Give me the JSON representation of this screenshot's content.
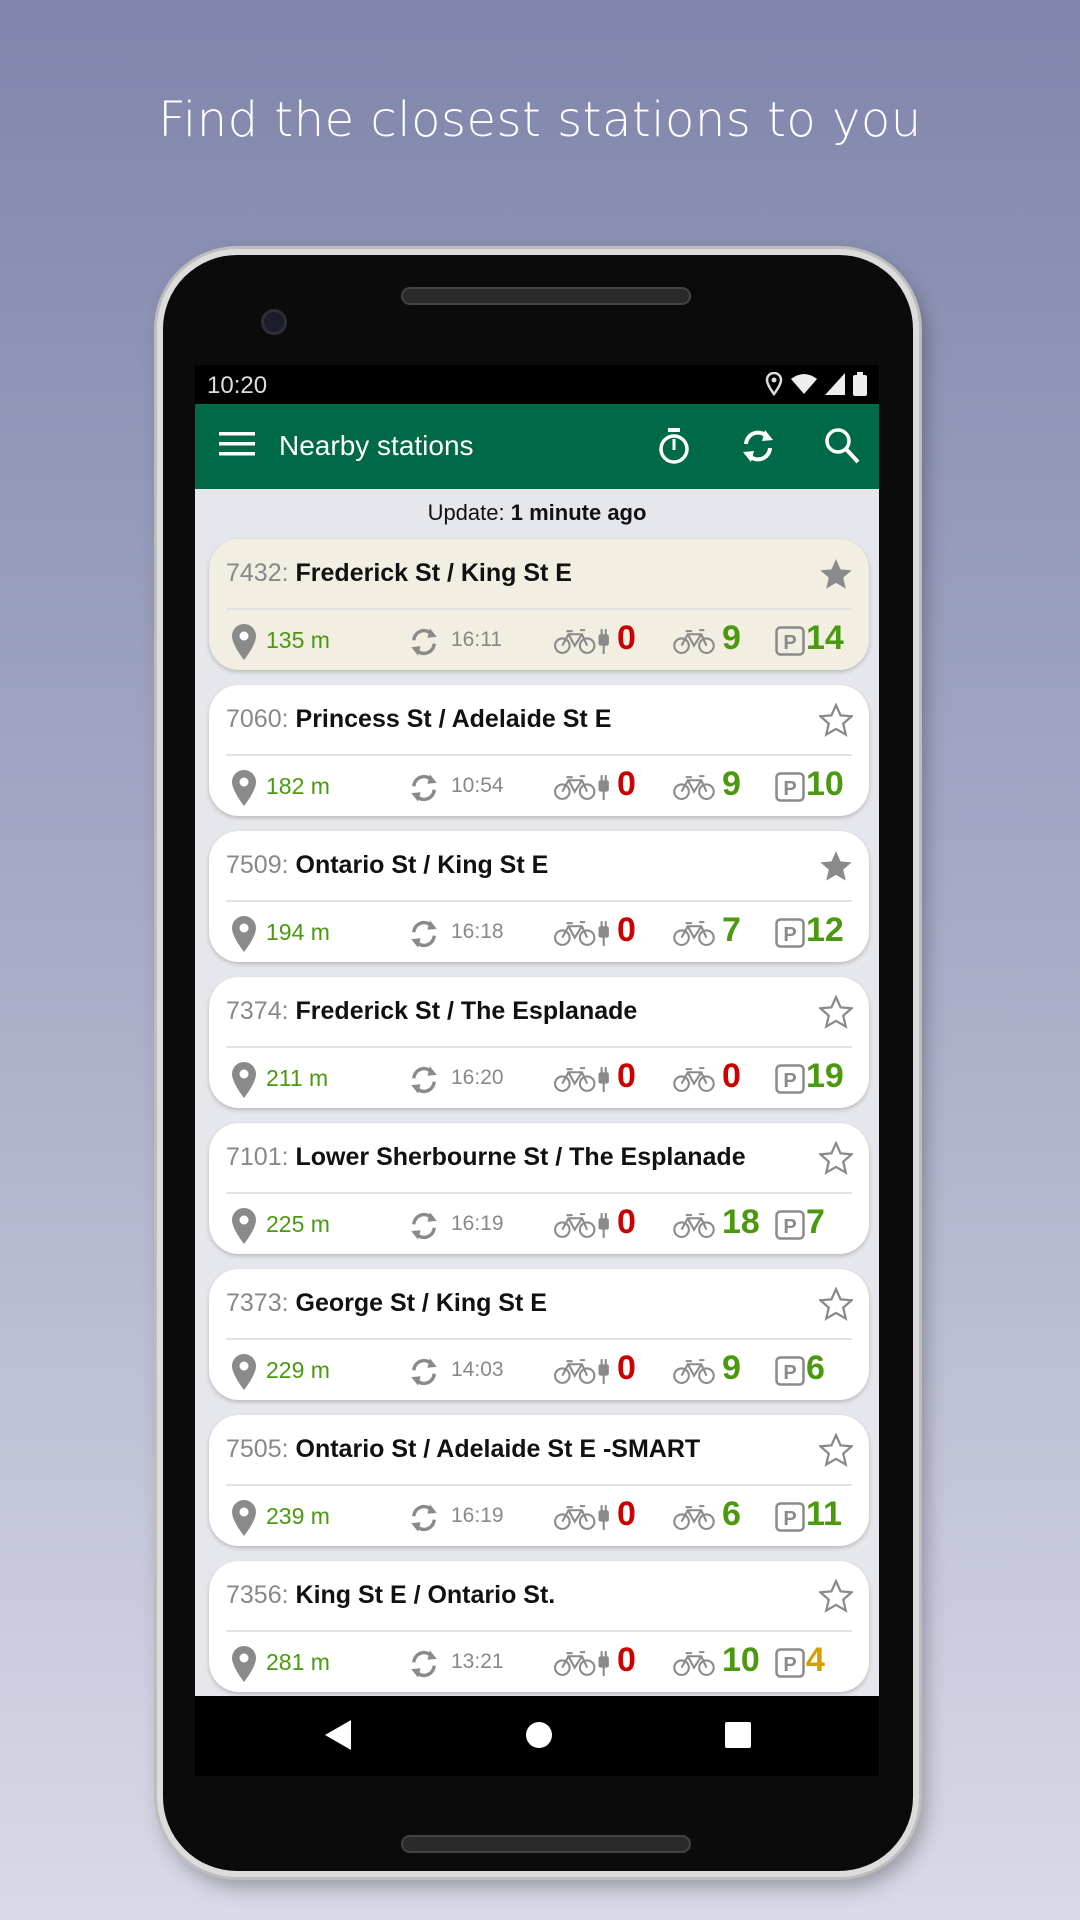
{
  "headline": "Find the closest stations to you",
  "status_bar": {
    "time": "10:20"
  },
  "app_bar": {
    "title": "Nearby stations",
    "icons": [
      "menu-icon",
      "timer-icon",
      "refresh-icon",
      "search-icon"
    ]
  },
  "update": {
    "label": "Update:",
    "value": "1 minute ago"
  },
  "colors": {
    "app_bar": "#006947",
    "distance": "#4a990f",
    "zero": "#cc0000",
    "good": "#4a990f",
    "low": "#d4a000",
    "highlight_card": "#f2eee2"
  },
  "stations": [
    {
      "id": "7432:",
      "name": "Frederick St / King St E",
      "favorite": true,
      "highlighted": true,
      "distance": "135 m",
      "updated": "16:11",
      "ebikes": "0",
      "bikes": "9",
      "docks": "14",
      "ebikes_color": "#cc0000",
      "bikes_color": "#4a990f",
      "docks_color": "#4a990f"
    },
    {
      "id": "7060:",
      "name": "Princess St / Adelaide St E",
      "favorite": false,
      "highlighted": false,
      "distance": "182 m",
      "updated": "10:54",
      "ebikes": "0",
      "bikes": "9",
      "docks": "10",
      "ebikes_color": "#cc0000",
      "bikes_color": "#4a990f",
      "docks_color": "#4a990f"
    },
    {
      "id": "7509:",
      "name": "Ontario St / King St E",
      "favorite": true,
      "highlighted": false,
      "distance": "194 m",
      "updated": "16:18",
      "ebikes": "0",
      "bikes": "7",
      "docks": "12",
      "ebikes_color": "#cc0000",
      "bikes_color": "#4a990f",
      "docks_color": "#4a990f"
    },
    {
      "id": "7374:",
      "name": "Frederick St / The Esplanade",
      "favorite": false,
      "highlighted": false,
      "distance": "211 m",
      "updated": "16:20",
      "ebikes": "0",
      "bikes": "0",
      "docks": "19",
      "ebikes_color": "#cc0000",
      "bikes_color": "#cc0000",
      "docks_color": "#4a990f"
    },
    {
      "id": "7101:",
      "name": "Lower Sherbourne St / The Esplanade",
      "favorite": false,
      "highlighted": false,
      "distance": "225 m",
      "updated": "16:19",
      "ebikes": "0",
      "bikes": "18",
      "docks": "7",
      "ebikes_color": "#cc0000",
      "bikes_color": "#4a990f",
      "docks_color": "#4a990f"
    },
    {
      "id": "7373:",
      "name": "George St / King St E",
      "favorite": false,
      "highlighted": false,
      "distance": "229 m",
      "updated": "14:03",
      "ebikes": "0",
      "bikes": "9",
      "docks": "6",
      "ebikes_color": "#cc0000",
      "bikes_color": "#4a990f",
      "docks_color": "#4a990f"
    },
    {
      "id": "7505:",
      "name": "Ontario St / Adelaide St E -SMART",
      "favorite": false,
      "highlighted": false,
      "distance": "239 m",
      "updated": "16:19",
      "ebikes": "0",
      "bikes": "6",
      "docks": "11",
      "ebikes_color": "#cc0000",
      "bikes_color": "#4a990f",
      "docks_color": "#4a990f"
    },
    {
      "id": "7356:",
      "name": "King St E / Ontario St.",
      "favorite": false,
      "highlighted": false,
      "distance": "281 m",
      "updated": "13:21",
      "ebikes": "0",
      "bikes": "10",
      "docks": "4",
      "ebikes_color": "#cc0000",
      "bikes_color": "#4a990f",
      "docks_color": "#d4a000"
    }
  ]
}
